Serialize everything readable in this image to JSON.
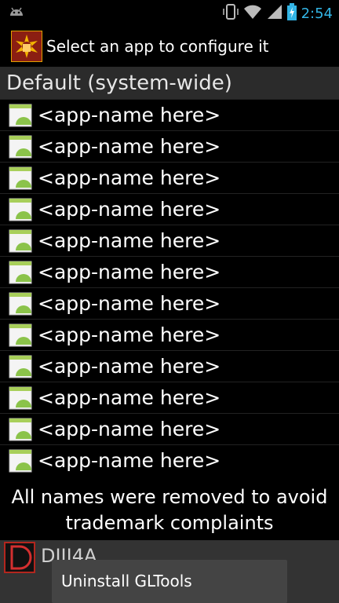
{
  "status_bar": {
    "time": "2:54",
    "icons": [
      "android-icon",
      "vibrate-icon",
      "wifi-icon",
      "signal-icon",
      "battery-charging-icon"
    ]
  },
  "header": {
    "title": "Select an app to configure it",
    "icon": "gltools-app-icon"
  },
  "list": {
    "header": "Default (system-wide)",
    "items": [
      {
        "label": "<app-name here>"
      },
      {
        "label": "<app-name here>"
      },
      {
        "label": "<app-name here>"
      },
      {
        "label": "<app-name here>"
      },
      {
        "label": "<app-name here>"
      },
      {
        "label": "<app-name here>"
      },
      {
        "label": "<app-name here>"
      },
      {
        "label": "<app-name here>"
      },
      {
        "label": "<app-name here>"
      },
      {
        "label": "<app-name here>"
      },
      {
        "label": "<app-name here>"
      },
      {
        "label": "<app-name here>"
      }
    ]
  },
  "notice": {
    "line1": "All names were removed to avoid",
    "line2": "trademark complaints"
  },
  "bottom_app": {
    "label": "DIII4A"
  },
  "toast": {
    "text": "Uninstall GLTools"
  },
  "colors": {
    "accent": "#33b5e5",
    "background": "#000000",
    "list_header_bg": "#2b2b2b"
  }
}
